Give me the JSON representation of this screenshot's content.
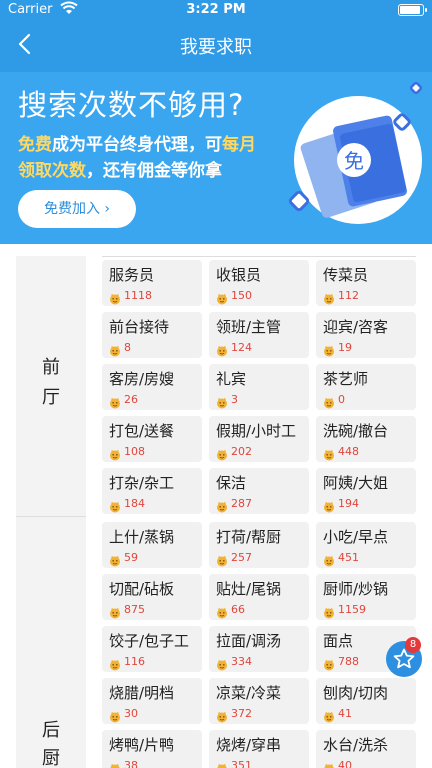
{
  "status_bar": {
    "carrier": "Carrier",
    "time": "3:22 PM"
  },
  "nav": {
    "title": "我要求职",
    "back_icon": "chevron-left-icon"
  },
  "banner": {
    "headline": "搜索次数不够用?",
    "line1_highlight": "免费",
    "line1_text": "成为平台终身代理，可",
    "line1_highlight2": "每月",
    "line2_highlight": "领取次数",
    "line2_text": "，还有佣金等你拿",
    "join_label": "免费加入 ›",
    "badge_char": "免",
    "colors": {
      "background": "#3aa6f0",
      "highlight": "#ffd860"
    }
  },
  "sections": [
    {
      "label_line1": "前",
      "label_line2": "厅",
      "items": [
        {
          "name": "服务员",
          "count": "1118"
        },
        {
          "name": "收银员",
          "count": "150"
        },
        {
          "name": "传菜员",
          "count": "112"
        },
        {
          "name": "前台接待",
          "count": "8"
        },
        {
          "name": "领班/主管",
          "count": "124"
        },
        {
          "name": "迎宾/咨客",
          "count": "19"
        },
        {
          "name": "客房/房嫂",
          "count": "26"
        },
        {
          "name": "礼宾",
          "count": "3"
        },
        {
          "name": "茶艺师",
          "count": "0"
        },
        {
          "name": "打包/送餐",
          "count": "108"
        },
        {
          "name": "假期/小时工",
          "count": "202"
        },
        {
          "name": "洗碗/撤台",
          "count": "448"
        },
        {
          "name": "打杂/杂工",
          "count": "184"
        },
        {
          "name": "保洁",
          "count": "287"
        },
        {
          "name": "阿姨/大姐",
          "count": "194"
        }
      ]
    },
    {
      "label_line1": "后",
      "label_line2": "厨",
      "items": [
        {
          "name": "上什/蒸锅",
          "count": "59"
        },
        {
          "name": "打荷/帮厨",
          "count": "257"
        },
        {
          "name": "小吃/早点",
          "count": "451"
        },
        {
          "name": "切配/砧板",
          "count": "875"
        },
        {
          "name": "贴灶/尾锅",
          "count": "66"
        },
        {
          "name": "厨师/炒锅",
          "count": "1159"
        },
        {
          "name": "饺子/包子工",
          "count": "116"
        },
        {
          "name": "拉面/调汤",
          "count": "334"
        },
        {
          "name": "面点",
          "count": "788"
        },
        {
          "name": "烧腊/明档",
          "count": "30"
        },
        {
          "name": "凉菜/冷菜",
          "count": "372"
        },
        {
          "name": "刨肉/切肉",
          "count": "41"
        },
        {
          "name": "烤鸭/片鸭",
          "count": "38"
        },
        {
          "name": "烧烤/穿串",
          "count": "351"
        },
        {
          "name": "水台/洗杀",
          "count": "40"
        }
      ]
    }
  ],
  "fab": {
    "badge": "8",
    "icon": "star-icon"
  },
  "count_icon": "face-icon"
}
